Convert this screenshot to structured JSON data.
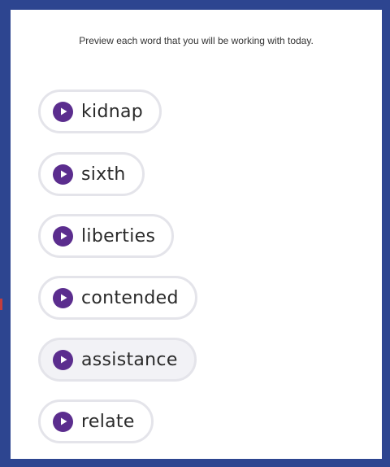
{
  "instructions": "Preview each word that you will be working with today.",
  "words": [
    {
      "label": "kidnap",
      "icon": "play-icon"
    },
    {
      "label": "sixth",
      "icon": "play-icon"
    },
    {
      "label": "liberties",
      "icon": "play-icon"
    },
    {
      "label": "contended",
      "icon": "play-icon"
    },
    {
      "label": "assistance",
      "icon": "play-icon",
      "state": "hovered"
    },
    {
      "label": "relate",
      "icon": "play-icon"
    }
  ],
  "colors": {
    "frame": "#2d4590",
    "play_button": "#5b2d8e",
    "pill_border": "#e4e4ea",
    "pill_hover": "#f2f2f6"
  }
}
